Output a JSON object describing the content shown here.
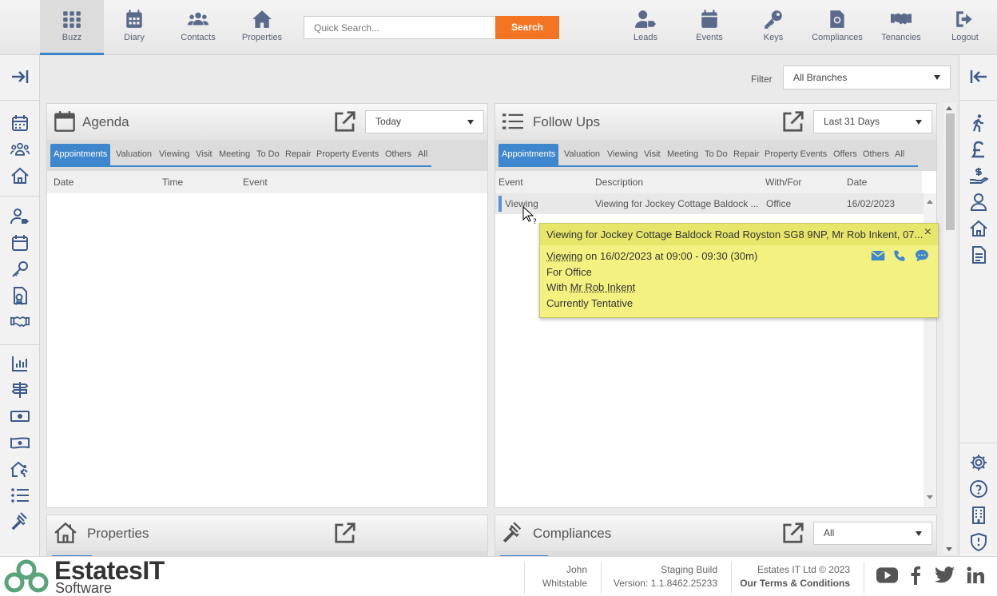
{
  "nav": {
    "left": [
      {
        "label": "Buzz",
        "icon": "grid-icon",
        "active": true
      },
      {
        "label": "Diary",
        "icon": "calendar-icon"
      },
      {
        "label": "Contacts",
        "icon": "users-icon"
      },
      {
        "label": "Properties",
        "icon": "house-icon"
      }
    ],
    "right": [
      {
        "label": "Leads",
        "icon": "user-tag-icon"
      },
      {
        "label": "Events",
        "icon": "calendar-icon"
      },
      {
        "label": "Keys",
        "icon": "key-icon"
      },
      {
        "label": "Compliances",
        "icon": "certificate-icon"
      },
      {
        "label": "Tenancies",
        "icon": "handshake-icon"
      },
      {
        "label": "Logout",
        "icon": "logout-icon"
      }
    ],
    "search_placeholder": "Quick Search...",
    "search_button": "Search"
  },
  "filter": {
    "label": "Filter",
    "value": "All Branches"
  },
  "agenda": {
    "title": "Agenda",
    "range": "Today",
    "tabs": [
      "Appointments",
      "Valuation",
      "Viewing",
      "Visit",
      "Meeting",
      "To Do",
      "Repair",
      "Property Events",
      "Others",
      "All"
    ],
    "columns": [
      "Date",
      "Time",
      "Event"
    ]
  },
  "followups": {
    "title": "Follow Ups",
    "range": "Last 31 Days",
    "tabs": [
      "Appointments",
      "Valuation",
      "Viewing",
      "Visit",
      "Meeting",
      "To Do",
      "Repair",
      "Property Events",
      "Offers",
      "Others",
      "All"
    ],
    "columns": [
      "Event",
      "Description",
      "With/For",
      "Date"
    ],
    "rows": [
      {
        "event": "Viewing",
        "description": "Viewing for Jockey Cottage Baldock ...",
        "withfor": "Office",
        "date": "16/02/2023"
      }
    ]
  },
  "tooltip": {
    "title": "Viewing for Jockey Cottage Baldock Road Royston SG8 9NP, Mr Rob Inkent, 07...",
    "type": "Viewing",
    "when": " on 16/02/2023 at 09:00 - 09:30 (30m)",
    "for": "For Office",
    "with_prefix": "With ",
    "with_name": "Mr Rob Inkent",
    "status": "Currently Tentative",
    "close": "×"
  },
  "properties_panel": {
    "title": "Properties"
  },
  "compliances_panel": {
    "title": "Compliances",
    "range": "All"
  },
  "footer": {
    "logo_main": "EstatesIT",
    "logo_sub": "Software",
    "user_name": "John",
    "user_branch": "Whitstable",
    "build": "Staging Build",
    "version": "Version: 1.1.8462.25233",
    "copyright": "Estates IT Ltd © 2023",
    "terms": "Our Terms & Conditions"
  },
  "colors": {
    "accent": "#3f87cc",
    "search": "#f47521",
    "icon": "#3d5a8a",
    "tooltip": "#f3f280"
  }
}
